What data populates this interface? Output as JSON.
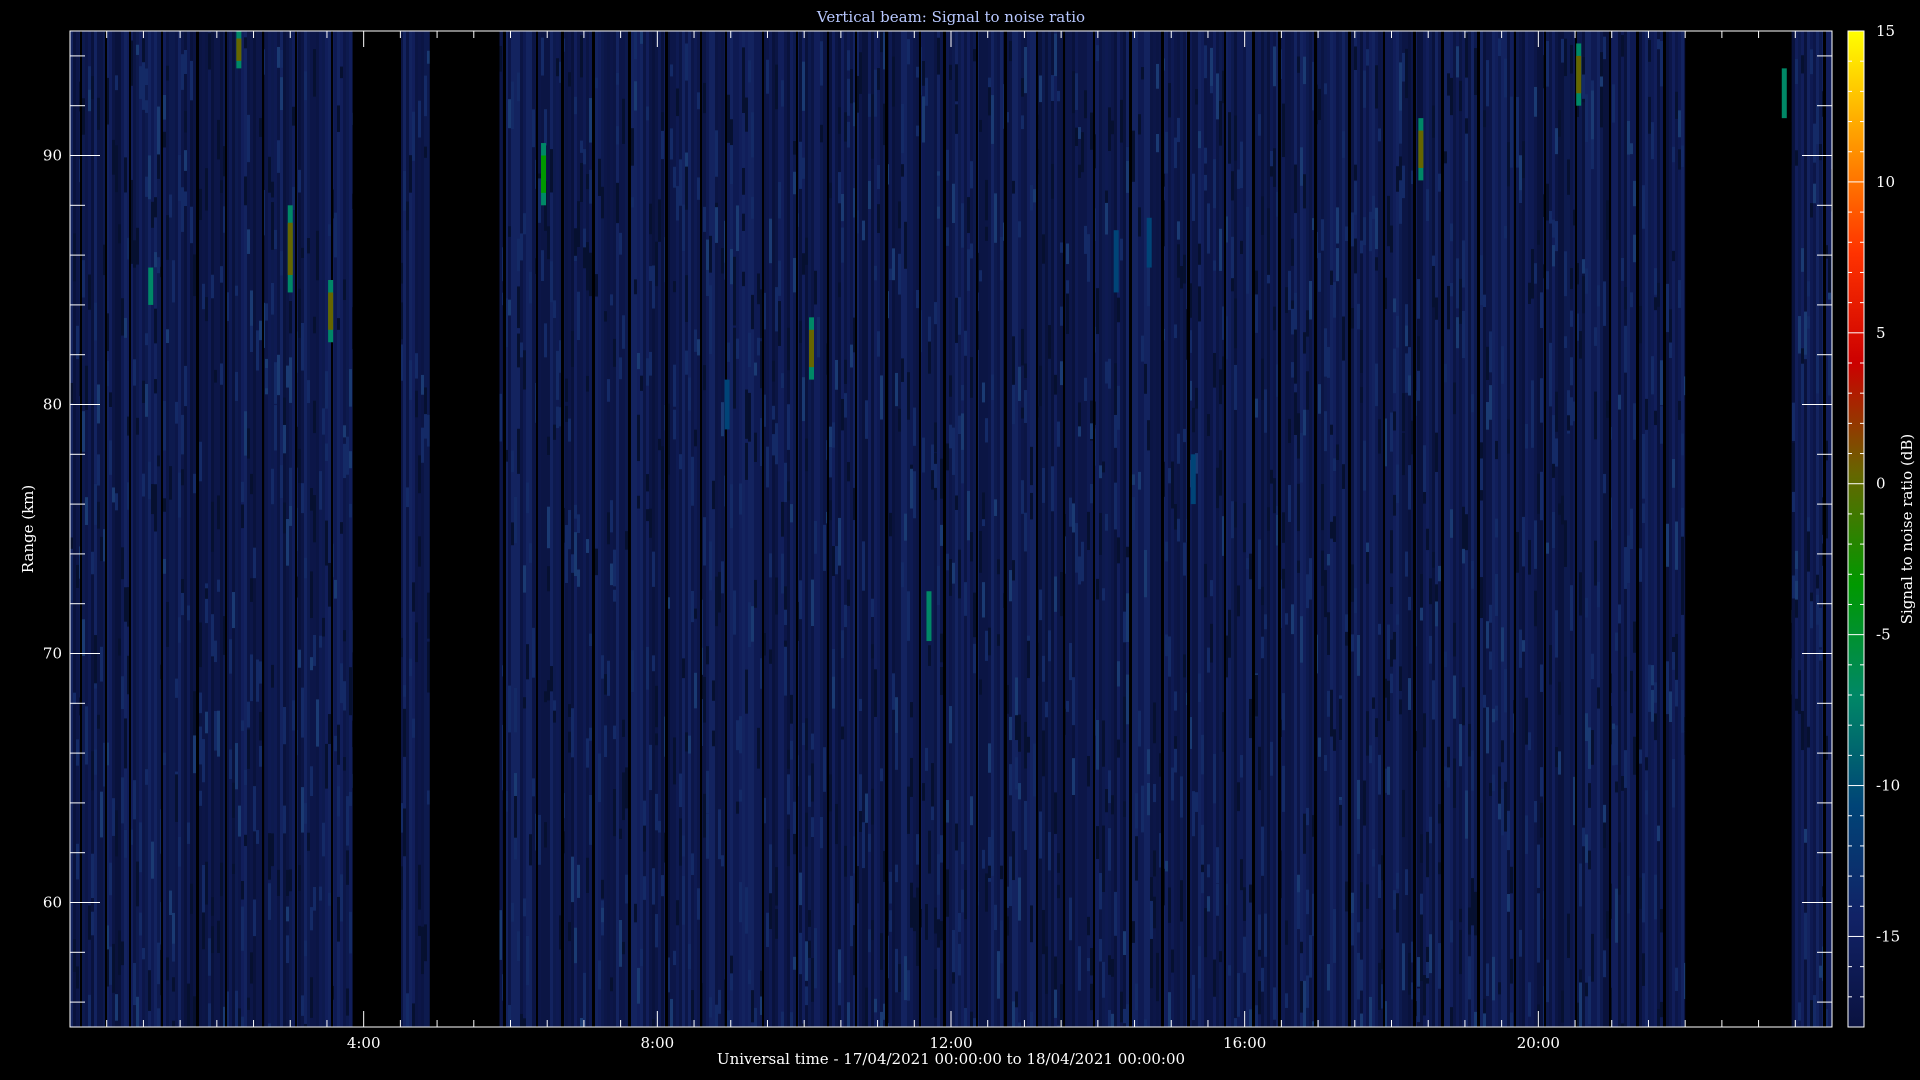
{
  "chart_data": {
    "type": "heatmap",
    "title": "Vertical beam: Signal to noise ratio",
    "xlabel": "Universal time - 17/04/2021 00:00:00 to 18/04/2021 00:00:00",
    "ylabel": "Range (km)",
    "xlim": [
      0,
      24
    ],
    "ylim": [
      55,
      95
    ],
    "x_ticks": [
      {
        "value": 4,
        "label": "4:00"
      },
      {
        "value": 8,
        "label": "8:00"
      },
      {
        "value": 12,
        "label": "12:00"
      },
      {
        "value": 16,
        "label": "16:00"
      },
      {
        "value": 20,
        "label": "20:00"
      }
    ],
    "y_ticks": [
      {
        "value": 60,
        "label": "60"
      },
      {
        "value": 70,
        "label": "70"
      },
      {
        "value": 80,
        "label": "80"
      },
      {
        "value": 90,
        "label": "90"
      }
    ],
    "colorbar": {
      "label": "Signal to noise ratio (dB)",
      "range": [
        -18,
        15
      ],
      "ticks": [
        {
          "value": 15,
          "label": "15"
        },
        {
          "value": 10,
          "label": "10"
        },
        {
          "value": 5,
          "label": "5"
        },
        {
          "value": 0,
          "label": "0"
        },
        {
          "value": -5,
          "label": "-5"
        },
        {
          "value": -10,
          "label": "-10"
        },
        {
          "value": -15,
          "label": "-15"
        }
      ],
      "colormap": [
        "#ffff00",
        "#ff9900",
        "#ff3300",
        "#cc0000",
        "#666600",
        "#009900",
        "#008866",
        "#004477",
        "#112266",
        "#0a1240"
      ]
    },
    "background_value_db": -16,
    "data_gaps_hours": [
      [
        3.85,
        4.5
      ],
      [
        4.9,
        5.85
      ],
      [
        22.0,
        23.45
      ]
    ],
    "features": [
      {
        "time": 2.3,
        "range": [
          93.5,
          95
        ],
        "peak_db": 0
      },
      {
        "time": 3.0,
        "range": [
          84.5,
          88
        ],
        "peak_db": 1
      },
      {
        "time": 3.55,
        "range": [
          82.5,
          85
        ],
        "peak_db": 1
      },
      {
        "time": 1.1,
        "range": [
          84,
          85.5
        ],
        "peak_db": -8
      },
      {
        "time": 6.45,
        "range": [
          88,
          90.5
        ],
        "peak_db": -3
      },
      {
        "time": 8.95,
        "range": [
          79,
          81
        ],
        "peak_db": -9
      },
      {
        "time": 10.1,
        "range": [
          81,
          83.5
        ],
        "peak_db": 1
      },
      {
        "time": 11.7,
        "range": [
          70.5,
          72.5
        ],
        "peak_db": -8
      },
      {
        "time": 14.25,
        "range": [
          84.5,
          87
        ],
        "peak_db": -9
      },
      {
        "time": 14.7,
        "range": [
          85.5,
          87.5
        ],
        "peak_db": -10
      },
      {
        "time": 15.3,
        "range": [
          76,
          78
        ],
        "peak_db": -10
      },
      {
        "time": 18.4,
        "range": [
          89,
          91.5
        ],
        "peak_db": 0
      },
      {
        "time": 20.55,
        "range": [
          92,
          94.5
        ],
        "peak_db": 1
      },
      {
        "time": 23.35,
        "range": [
          91.5,
          93.5
        ],
        "peak_db": -7
      }
    ]
  }
}
